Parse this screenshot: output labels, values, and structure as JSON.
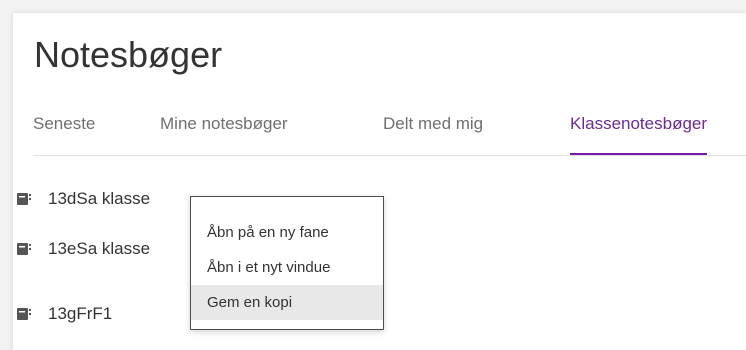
{
  "header": {
    "title": "Notesbøger"
  },
  "tabs": [
    {
      "label": "Seneste"
    },
    {
      "label": "Mine notesbøger"
    },
    {
      "label": "Delt med mig"
    },
    {
      "label": "Klassenotesbøger"
    }
  ],
  "active_tab": "Klassenotesbøger",
  "colors": {
    "accent": "#7719aa",
    "icon": "#555555"
  },
  "notebooks": [
    {
      "label": "13dSa klasse",
      "icon": "notebook-icon"
    },
    {
      "label": "13eSa klasse",
      "icon": "notebook-icon"
    },
    {
      "label": "13gFrF1",
      "icon": "notebook-icon"
    }
  ],
  "context_menu": {
    "items": [
      {
        "label": "Åbn på en ny fane"
      },
      {
        "label": "Åbn i et nyt vindue"
      },
      {
        "label": "Gem en kopi"
      }
    ],
    "highlighted": "Gem en kopi"
  }
}
